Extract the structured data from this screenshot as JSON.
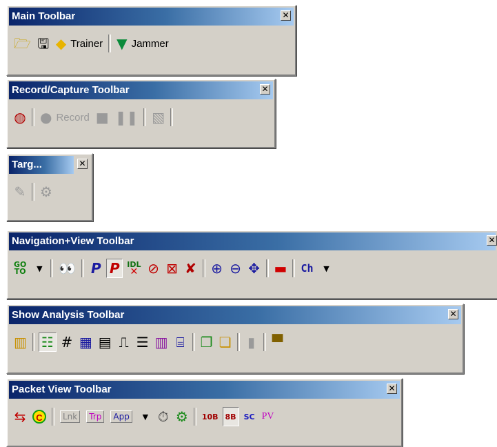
{
  "close_glyph": "✕",
  "main_toolbar": {
    "title": "Main Toolbar",
    "trainer_label": "Trainer",
    "jammer_label": "Jammer",
    "icons": [
      "open-folder-icon",
      "save-disk-icon",
      "trainer-diamond-icon",
      "jammer-shield-icon"
    ]
  },
  "record_toolbar": {
    "title": "Record/Capture Toolbar",
    "record_label": "Record",
    "icons": [
      "capture-config-icon",
      "record-dot-icon",
      "stop-icon",
      "pause-icon",
      "export-capture-icon"
    ]
  },
  "target_toolbar": {
    "title": "Targ..."
  },
  "nav_toolbar": {
    "title": "Navigation+View Toolbar",
    "goto_label_top": "GO",
    "goto_label_bottom": "TO",
    "idl_label": "IDL",
    "ch_label": "Ch"
  },
  "analysis_toolbar": {
    "title": "Show Analysis Toolbar"
  },
  "packet_toolbar": {
    "title": "Packet View Toolbar",
    "c_label": "C",
    "lnk_label": "Lnk",
    "trp_label": "Trp",
    "app_label": "App",
    "b10_label": "10B",
    "b8_label": "8B",
    "sc_label": "SC",
    "pv_label": "PV"
  },
  "colors": {
    "title_start": "#0a246a",
    "title_end": "#a6caf0",
    "face": "#d4d0c8"
  }
}
